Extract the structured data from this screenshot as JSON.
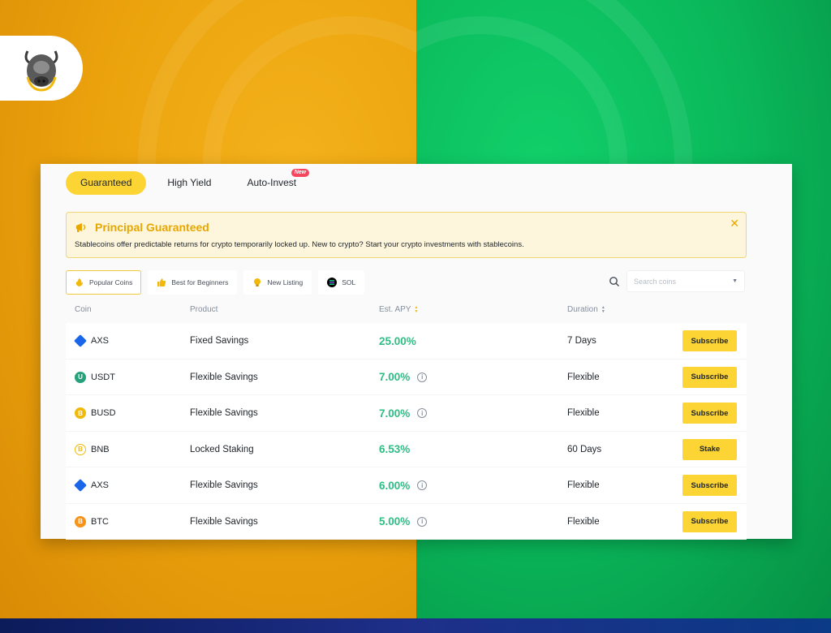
{
  "colors": {
    "accent": "#fcd535",
    "apy_green": "#2ebd85",
    "notice_title": "#e7a700",
    "bg_left": "#eca40d",
    "bg_right": "#0ab85a"
  },
  "logo": {
    "icon": "bull-logo-icon"
  },
  "tabs": [
    {
      "label": "Guaranteed",
      "active": true
    },
    {
      "label": "High Yield",
      "active": false
    },
    {
      "label": "Auto-Invest",
      "active": false,
      "badge": "New"
    }
  ],
  "notice": {
    "icon": "megaphone-icon",
    "title": "Principal Guaranteed",
    "text": "Stablecoins offer predictable returns for crypto temporarily locked up. New to crypto? Start your crypto investments with stablecoins.",
    "close_icon": "close-icon"
  },
  "filters": [
    {
      "label": "Popular Coins",
      "icon": "fire-icon",
      "active": true
    },
    {
      "label": "Best for Beginners",
      "icon": "thumbs-up-icon",
      "active": false
    },
    {
      "label": "New Listing",
      "icon": "lightbulb-icon",
      "active": false
    },
    {
      "label": "SOL",
      "icon": "sol-icon",
      "active": false
    }
  ],
  "search": {
    "placeholder": "Search coins",
    "icon": "search-icon"
  },
  "table": {
    "headers": {
      "coin": "Coin",
      "product": "Product",
      "apy": "Est. APY",
      "duration": "Duration"
    },
    "rows": [
      {
        "coin": "AXS",
        "coin_color": "#1a66e8",
        "product": "Fixed Savings",
        "apy": "25.00%",
        "info": false,
        "duration": "7 Days",
        "action": "Subscribe"
      },
      {
        "coin": "USDT",
        "coin_color": "#26a17b",
        "product": "Flexible Savings",
        "apy": "7.00%",
        "info": true,
        "duration": "Flexible",
        "action": "Subscribe"
      },
      {
        "coin": "BUSD",
        "coin_color": "#f0b90b",
        "product": "Flexible Savings",
        "apy": "7.00%",
        "info": true,
        "duration": "Flexible",
        "action": "Subscribe"
      },
      {
        "coin": "BNB",
        "coin_color": "#f0b90b",
        "product": "Locked Staking",
        "apy": "6.53%",
        "info": false,
        "duration": "60 Days",
        "action": "Stake"
      },
      {
        "coin": "AXS",
        "coin_color": "#1a66e8",
        "product": "Flexible Savings",
        "apy": "6.00%",
        "info": true,
        "duration": "Flexible",
        "action": "Subscribe"
      },
      {
        "coin": "BTC",
        "coin_color": "#f7931a",
        "product": "Flexible Savings",
        "apy": "5.00%",
        "info": true,
        "duration": "Flexible",
        "action": "Subscribe"
      }
    ]
  }
}
